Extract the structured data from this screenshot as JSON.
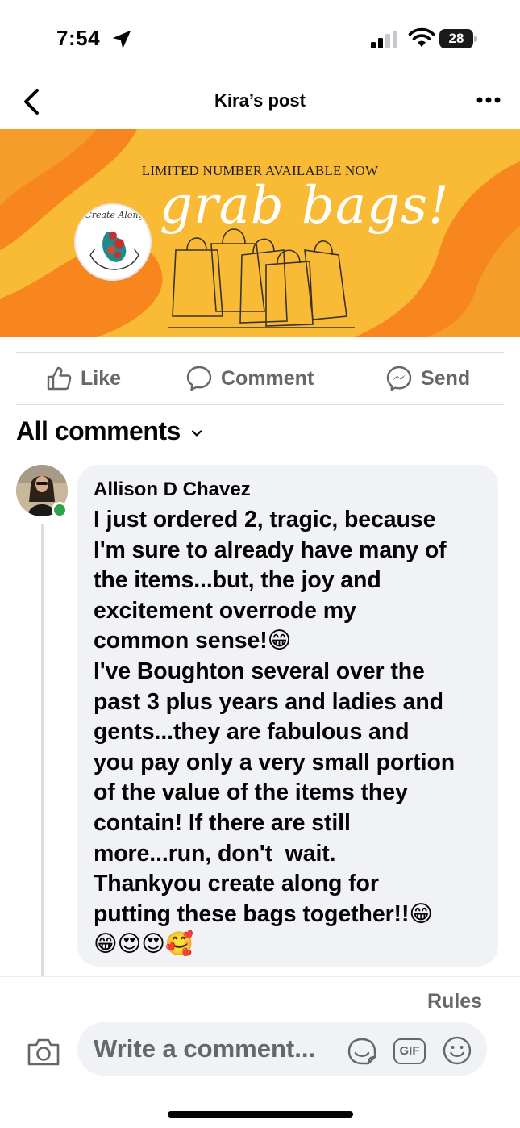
{
  "status_bar": {
    "time": "7:54",
    "battery": "28"
  },
  "nav": {
    "title": "Kira’s post"
  },
  "banner": {
    "subtitle": "LIMITED NUMBER AVAILABLE NOW",
    "headline": "grab bags!",
    "logo_text": "Create Along",
    "colors": {
      "background": "#f7b733",
      "wave": "#f7841d"
    }
  },
  "actions": {
    "like": "Like",
    "comment": "Comment",
    "send": "Send"
  },
  "comments_header": "All comments",
  "comment": {
    "author": "Allison D Chavez",
    "text": "I just ordered 2, tragic, because\nI'm sure to already have many of\nthe items...but, the joy and\nexcitement overrode my\ncommon sense!😁\nI've Boughton several over the\npast 3 plus years and ladies and\ngents...they are fabulous and\nyou pay only a very small portion\nof the value of the items they\ncontain! If there are still\nmore...run, don't  wait.\nThankyou create along for\nputting these bags together!!😁\n😁😍😍🥰"
  },
  "footer": {
    "rules": "Rules",
    "input_placeholder": "Write a comment...",
    "gif_label": "GIF"
  },
  "icons": {
    "location": "location-arrow-icon",
    "signal": "cellular-signal-icon",
    "wifi": "wifi-icon",
    "back": "chevron-left-icon",
    "more": "more-dots-icon",
    "like": "thumbs-up-icon",
    "comment": "speech-bubble-icon",
    "send": "messenger-icon",
    "camera": "camera-icon",
    "sticker": "sticker-icon",
    "gif": "gif-icon",
    "emoji": "smiley-icon"
  }
}
